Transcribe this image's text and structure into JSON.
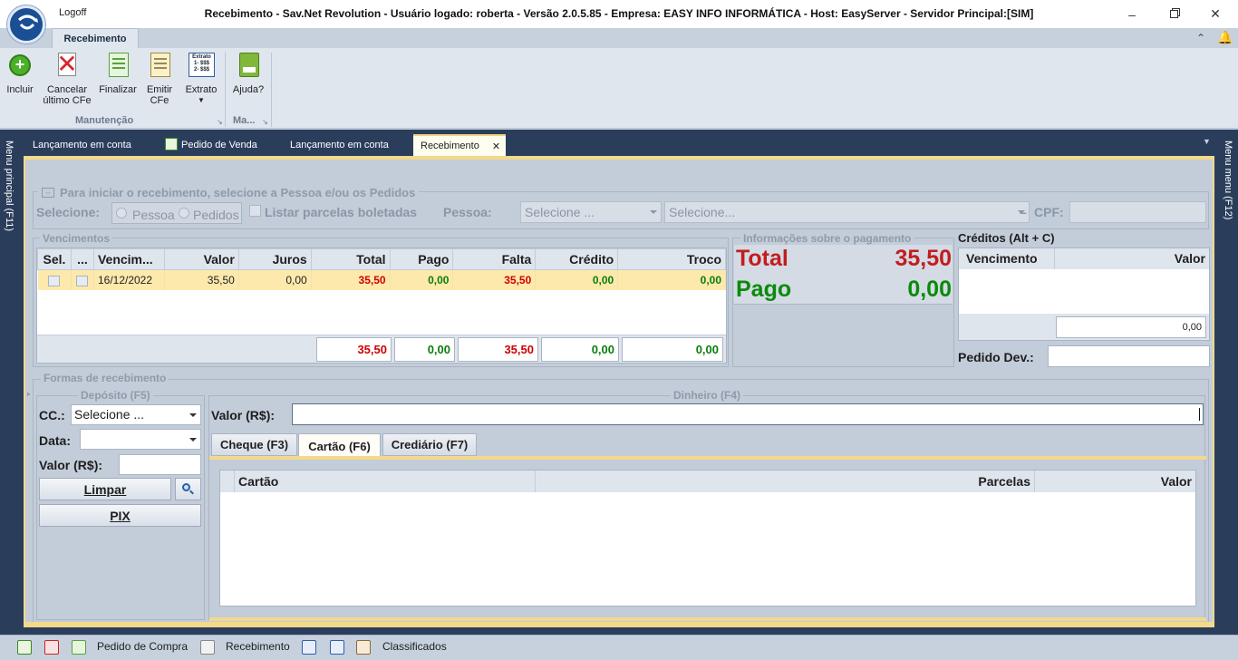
{
  "window": {
    "logoff": "Logoff",
    "title": "Recebimento - Sav.Net Revolution - Usuário logado: roberta - Versão 2.0.5.85 - Empresa: EASY INFO INFORMÁTICA - Host: EasyServer - Servidor Principal:[SIM]"
  },
  "ribbon": {
    "tab": "Recebimento",
    "buttons": {
      "incluir": "Incluir",
      "cancelar_1": "Cancelar",
      "cancelar_2": "último CFe",
      "finalizar": "Finalizar",
      "emitir_1": "Emitir",
      "emitir_2": "CFe",
      "extrato": "Extrato",
      "extrato_icon_1": "Extrato",
      "extrato_icon_2": "1- $$$",
      "extrato_icon_3": "2- $$$",
      "ajuda": "Ajuda?"
    },
    "groups": {
      "manutencao": "Manutenção",
      "ma": "Ma..."
    }
  },
  "side": {
    "left": "Menu principal (F11)",
    "right": "Menu menu (F12)"
  },
  "doc_tabs": [
    "Lançamento em conta",
    "Pedido de Venda",
    "Lançamento em conta",
    "Recebimento"
  ],
  "iniciar": {
    "title": "Para iniciar o recebimento, selecione a Pessoa e/ou os Pedidos",
    "selecione_label": "Selecione:",
    "radio_pessoa": "Pessoa",
    "radio_pedidos": "Pedidos",
    "listar": "Listar parcelas boletadas",
    "pessoa_label": "Pessoa:",
    "pessoa_combo": "Selecione ...",
    "pessoa_nome": "Selecione...",
    "dash": "–",
    "cpf_label": "CPF:"
  },
  "vencimentos": {
    "title": "Vencimentos",
    "headers": [
      "Sel.",
      "...",
      "Vencim...",
      "Valor",
      "Juros",
      "Total",
      "Pago",
      "Falta",
      "Crédito",
      "Troco"
    ],
    "rows": [
      {
        "vencimento": "16/12/2022",
        "valor": "35,50",
        "juros": "0,00",
        "total": "35,50",
        "pago": "0,00",
        "falta": "35,50",
        "credito": "0,00",
        "troco": "0,00"
      }
    ],
    "totals": {
      "total": "35,50",
      "pago": "0,00",
      "falta": "35,50",
      "credito": "0,00",
      "troco": "0,00"
    }
  },
  "info": {
    "title": "Informações sobre o pagamento",
    "total_label": "Total",
    "total_value": "35,50",
    "pago_label": "Pago",
    "pago_value": "0,00"
  },
  "creditos": {
    "title": "Créditos (Alt + C)",
    "headers": [
      "Vencimento",
      "Valor"
    ],
    "sum": "0,00",
    "pedido_dev_label": "Pedido Dev.:"
  },
  "formas": {
    "title": "Formas de recebimento",
    "deposito": {
      "title": "Depósito (F5)",
      "cc_label": "CC.:",
      "cc_value": "Selecione ...",
      "data_label": "Data:",
      "valor_label": "Valor (R$):",
      "limpar": "Limpar",
      "pix": "PIX"
    },
    "dinheiro": {
      "title": "Dinheiro (F4)",
      "valor_label": "Valor (R$):"
    },
    "tabs": [
      "Cheque (F3)",
      "Cartão (F6)",
      "Crediário (F7)"
    ],
    "cartao_headers": [
      "Cartão",
      "Parcelas",
      "Valor"
    ]
  },
  "statusbar": {
    "pedido_compra": "Pedido de Compra",
    "recebimento": "Recebimento",
    "classificados": "Classificados"
  },
  "colors": {
    "red": "#d10000",
    "green": "#0b7d0b",
    "highlight": "#fde9ac",
    "accent": "#f4d27b"
  }
}
